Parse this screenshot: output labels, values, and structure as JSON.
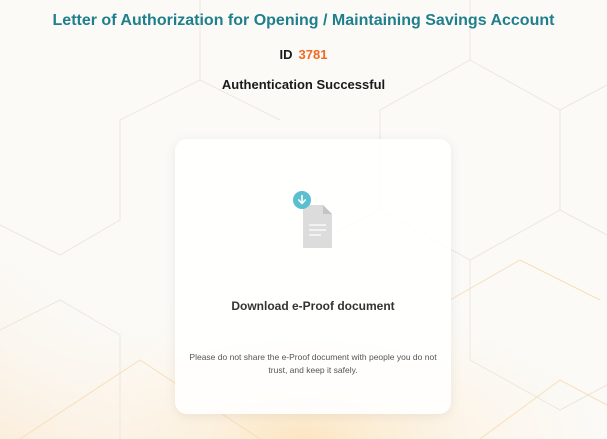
{
  "header": {
    "title": "Letter of Authorization for Opening / Maintaining Savings Account",
    "id_label": "ID",
    "id_value": "3781",
    "status": "Authentication Successful"
  },
  "card": {
    "icon": "download-document-icon",
    "download_label": "Download e-Proof document",
    "notice": "Please do not share the e-Proof document with people you do not trust, and keep it safely."
  },
  "colors": {
    "title": "#1f7f8c",
    "id_value": "#f26a21",
    "download_badge": "#5bbfcf"
  }
}
